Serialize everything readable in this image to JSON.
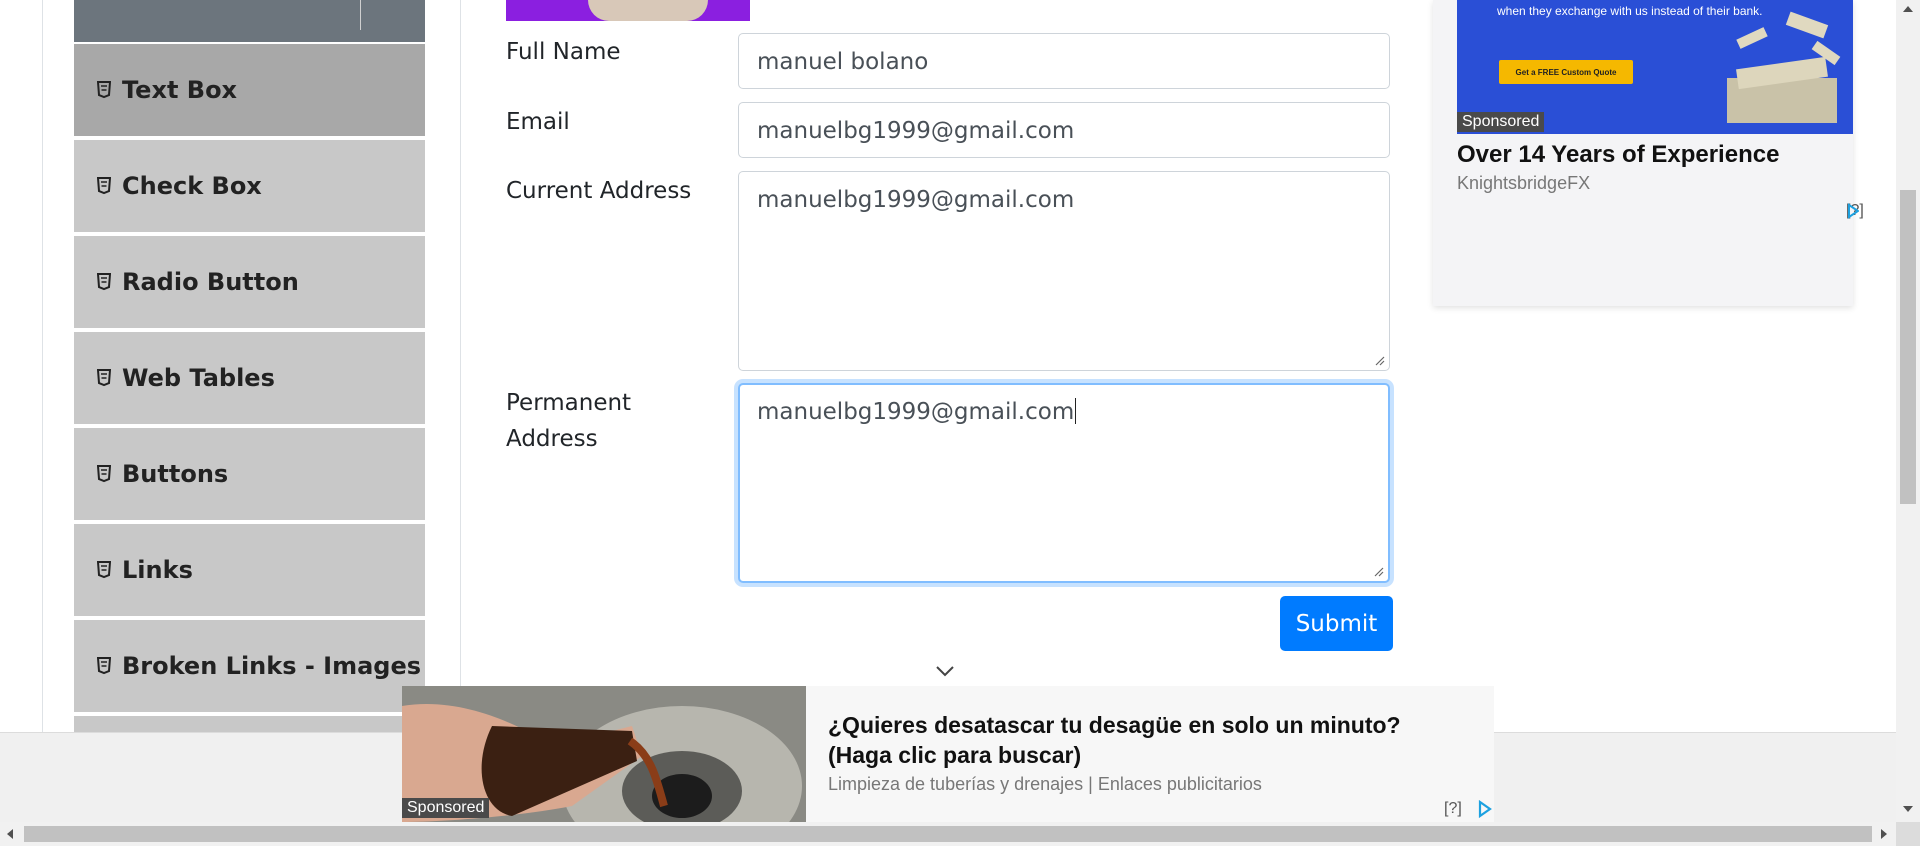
{
  "sidebar": {
    "items": [
      {
        "label": "Text Box",
        "active": true
      },
      {
        "label": "Check Box"
      },
      {
        "label": "Radio Button"
      },
      {
        "label": "Web Tables"
      },
      {
        "label": "Buttons"
      },
      {
        "label": "Links"
      },
      {
        "label": "Broken Links - Images"
      }
    ],
    "icon": "html5-icon"
  },
  "form": {
    "full_name": {
      "label": "Full Name",
      "value": "manuel bolano"
    },
    "email": {
      "label": "Email",
      "value": "manuelbg1999@gmail.com"
    },
    "current_address": {
      "label": "Current Address",
      "value": "manuelbg1999@gmail.com"
    },
    "permanent_address": {
      "label_line1": "Permanent",
      "label_line2": "Address",
      "value": "manuelbg1999@gmail.com"
    },
    "submit_label": "Submit"
  },
  "ad_right": {
    "banner_text": "when they exchange with us instead of their bank.",
    "banner_button": "Get a FREE Custom Quote",
    "sponsored": "Sponsored",
    "title": "Over 14 Years of Experience",
    "source": "KnightsbridgeFX",
    "info": "[?]"
  },
  "ad_bottom": {
    "sponsored": "Sponsored",
    "headline": "¿Quieres desatascar tu desagüe en solo un minuto? (Haga clic para buscar)",
    "subtitle": "Limpieza de tuberías y drenajes | Enlaces publicitarios",
    "info": "[?]"
  },
  "colors": {
    "primary": "#007bff",
    "sidebar_bg": "#c8c8c8",
    "sidebar_active": "#a8a8a8",
    "focus_border": "#80bdff"
  }
}
